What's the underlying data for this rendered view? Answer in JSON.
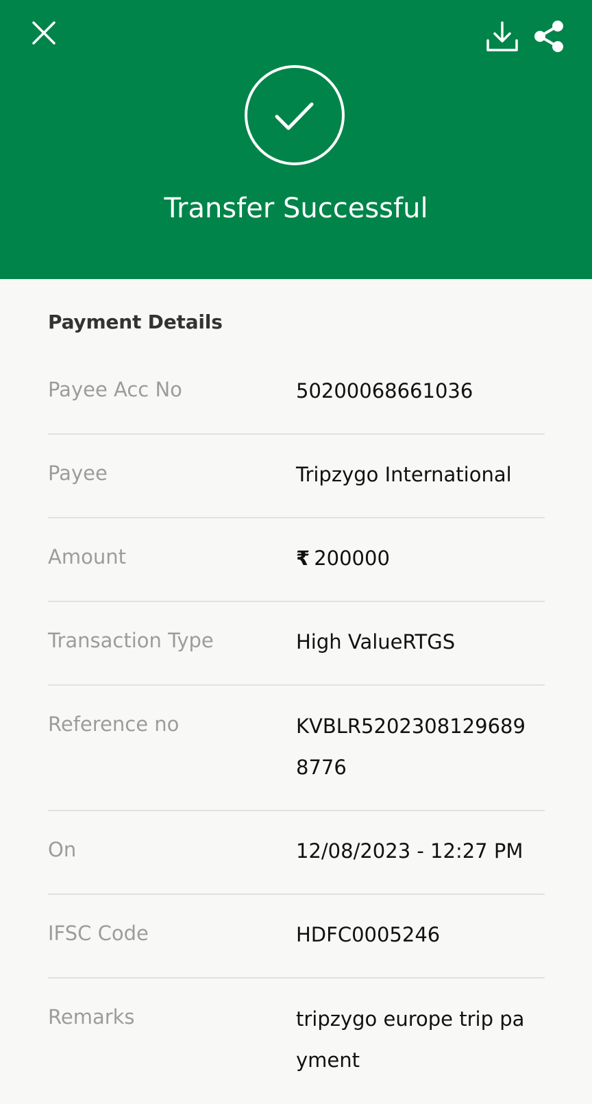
{
  "header": {
    "title": "Transfer Successful",
    "background_color": "#00844a",
    "icons": {
      "close": "close-icon",
      "download": "download-icon",
      "share": "share-icon",
      "success": "check-circle-icon"
    }
  },
  "payment_details": {
    "heading": "Payment Details",
    "rows": [
      {
        "label": "Payee Acc No",
        "value": "50200068661036"
      },
      {
        "label": "Payee",
        "value": "Tripzygo International"
      },
      {
        "label": "Amount",
        "currency_symbol": "₹",
        "value": "200000"
      },
      {
        "label": "Transaction Type",
        "value": "High ValueRTGS"
      },
      {
        "label": "Reference no",
        "value": "KVBLR52023081296898776"
      },
      {
        "label": "On",
        "value": "12/08/2023 - 12:27 PM"
      },
      {
        "label": "IFSC Code",
        "value": "HDFC0005246"
      },
      {
        "label": "Remarks",
        "value": "tripzygo europe trip payment"
      }
    ]
  }
}
